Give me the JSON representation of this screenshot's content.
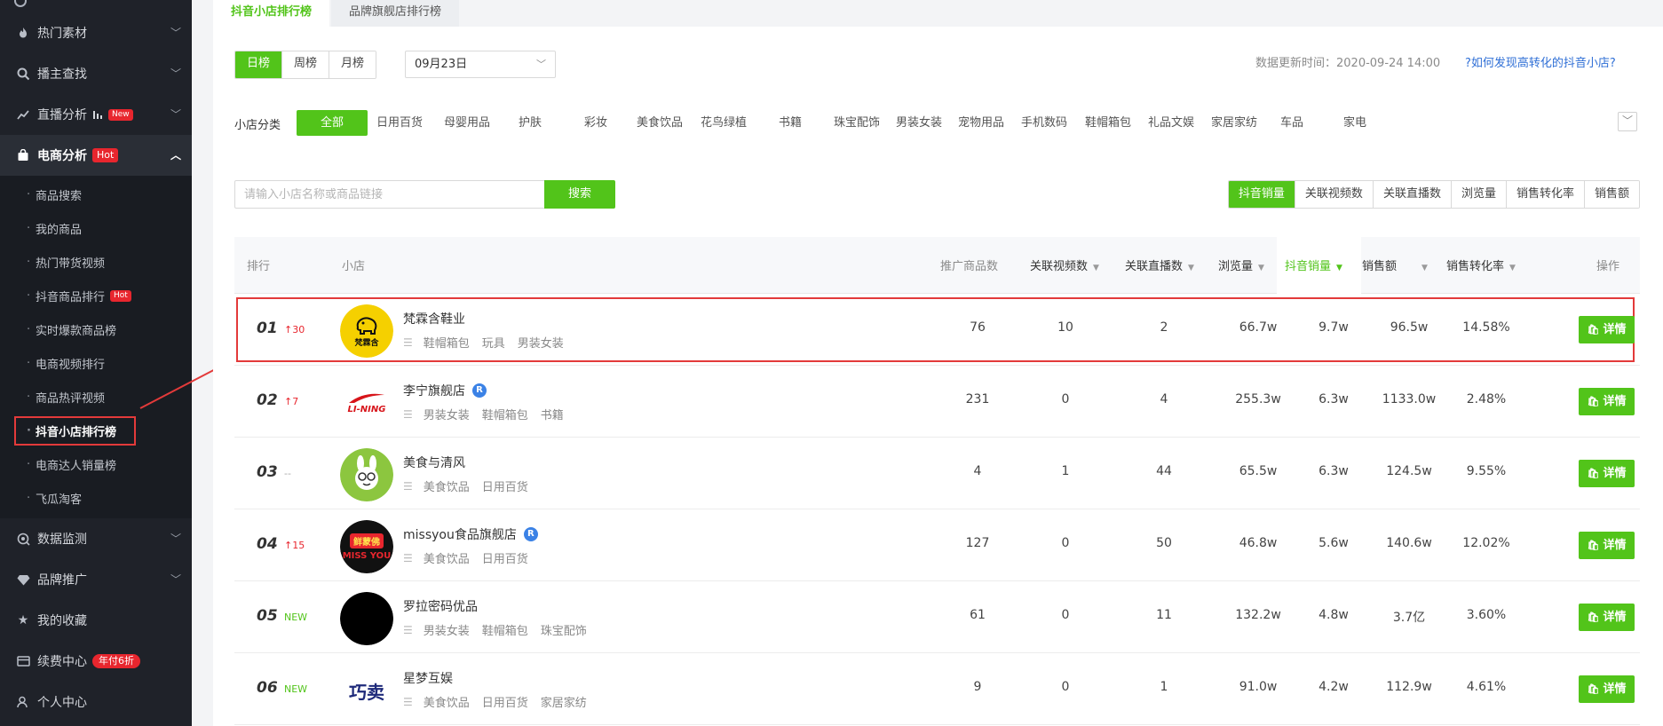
{
  "sidebar": {
    "items": [
      {
        "label": "热门素材",
        "icon": "fire-icon"
      },
      {
        "label": "播主查找",
        "icon": "search-icon"
      },
      {
        "label": "直播分析",
        "icon": "chart-icon",
        "badge": "New"
      },
      {
        "label": "电商分析",
        "icon": "shopping-bag-icon",
        "badge": "Hot"
      }
    ],
    "sub_items": [
      {
        "label": "商品搜索"
      },
      {
        "label": "我的商品"
      },
      {
        "label": "热门带货视频"
      },
      {
        "label": "抖音商品排行",
        "badge": "Hot"
      },
      {
        "label": "实时爆款商品榜"
      },
      {
        "label": "电商视频排行"
      },
      {
        "label": "商品热评视频"
      },
      {
        "label": "抖音小店排行榜"
      },
      {
        "label": "电商达人销量榜"
      },
      {
        "label": "飞瓜淘客"
      }
    ],
    "bottom_items": [
      {
        "label": "数据监测",
        "icon": "monitor-icon"
      },
      {
        "label": "品牌推广",
        "icon": "diamond-icon"
      },
      {
        "label": "我的收藏",
        "icon": "star-icon"
      },
      {
        "label": "续费中心",
        "icon": "card-icon",
        "badge": "年付6折"
      },
      {
        "label": "个人中心",
        "icon": "user-icon"
      }
    ]
  },
  "tabs": [
    "抖音小店排行榜",
    "品牌旗舰店排行榜"
  ],
  "period": {
    "options": [
      "日榜",
      "周榜",
      "月榜"
    ],
    "selected": "日榜"
  },
  "date_select": {
    "value": "09月23日"
  },
  "update_time": "数据更新时间：2020-09-24 14:00",
  "help_link": "?如何发现高转化的抖音小店?",
  "category": {
    "label": "小店分类",
    "items": [
      "全部",
      "日用百货",
      "母婴用品",
      "护肤",
      "彩妆",
      "美食饮品",
      "花鸟绿植",
      "书籍",
      "珠宝配饰",
      "男装女装",
      "宠物用品",
      "手机数码",
      "鞋帽箱包",
      "礼品文娱",
      "家居家纺",
      "车品",
      "家电"
    ],
    "selected": "全部"
  },
  "search": {
    "placeholder": "请输入小店名称或商品链接",
    "button": "搜索"
  },
  "metrics": {
    "options": [
      "抖音销量",
      "关联视频数",
      "关联直播数",
      "浏览量",
      "销售转化率",
      "销售额"
    ],
    "selected": "抖音销量"
  },
  "table": {
    "headers": {
      "rank": "排行",
      "shop": "小店",
      "promo_goods": "推广商品数",
      "videos": "关联视频数",
      "lives": "关联直播数",
      "views": "浏览量",
      "sales": "抖音销量",
      "revenue": "销售额",
      "conversion": "销售转化率",
      "action": "操作"
    },
    "detail_label": "详情",
    "rows": [
      {
        "rank": "01",
        "change": "↑30",
        "change_type": "up",
        "name": "梵霖含鞋业",
        "verified": false,
        "tags": [
          "鞋帽箱包",
          "玩具",
          "男装女装"
        ],
        "promo_goods": "76",
        "videos": "10",
        "lives": "2",
        "views": "66.7w",
        "sales": "9.7w",
        "revenue": "96.5w",
        "conversion": "14.58%",
        "logo": "fanlinhan"
      },
      {
        "rank": "02",
        "change": "↑7",
        "change_type": "up",
        "name": "李宁旗舰店",
        "verified": true,
        "tags": [
          "男装女装",
          "鞋帽箱包",
          "书籍"
        ],
        "promo_goods": "231",
        "videos": "0",
        "lives": "4",
        "views": "255.3w",
        "sales": "6.3w",
        "revenue": "1133.0w",
        "conversion": "2.48%",
        "logo": "lining"
      },
      {
        "rank": "03",
        "change": "--",
        "change_type": "none",
        "name": "美食与清风",
        "verified": false,
        "tags": [
          "美食饮品",
          "日用百货"
        ],
        "promo_goods": "4",
        "videos": "1",
        "lives": "44",
        "views": "65.5w",
        "sales": "6.3w",
        "revenue": "124.5w",
        "conversion": "9.55%",
        "logo": "meishi"
      },
      {
        "rank": "04",
        "change": "↑15",
        "change_type": "up",
        "name": "missyou食品旗舰店",
        "verified": true,
        "tags": [
          "美食饮品",
          "日用百货"
        ],
        "promo_goods": "127",
        "videos": "0",
        "lives": "50",
        "views": "46.8w",
        "sales": "5.6w",
        "revenue": "140.6w",
        "conversion": "12.02%",
        "logo": "missyou"
      },
      {
        "rank": "05",
        "change": "NEW",
        "change_type": "new",
        "name": "罗拉密码优品",
        "verified": false,
        "tags": [
          "男装女装",
          "鞋帽箱包",
          "珠宝配饰"
        ],
        "promo_goods": "61",
        "videos": "0",
        "lives": "11",
        "views": "132.2w",
        "sales": "4.8w",
        "revenue": "3.7亿",
        "conversion": "3.60%",
        "logo": "black"
      },
      {
        "rank": "06",
        "change": "NEW",
        "change_type": "new",
        "name": "星梦互娱",
        "verified": false,
        "tags": [
          "美食饮品",
          "日用百货",
          "家居家纺"
        ],
        "promo_goods": "9",
        "videos": "0",
        "lives": "1",
        "views": "91.0w",
        "sales": "4.2w",
        "revenue": "112.9w",
        "conversion": "4.61%",
        "logo": "qiaomai"
      }
    ]
  },
  "logos": {
    "fanlinhan": {
      "text": "梵霖含",
      "bg": "#f5d000"
    },
    "lining": {
      "text": "LI-NING",
      "color": "#d7141a"
    },
    "meishi": {
      "bg": "#8cc63f"
    },
    "missyou": {
      "text_top": "鲜蒙佛",
      "text_bottom": "MISS YOU",
      "bg": "#111111",
      "accent": "#e8262e"
    },
    "qiaomai": {
      "text": "巧卖",
      "color": "#1e2a7a"
    }
  },
  "colors": {
    "accent": "#52c41a",
    "sidebar_bg": "#1f2229",
    "hot": "#e8262e",
    "link": "#2f6fd6"
  }
}
